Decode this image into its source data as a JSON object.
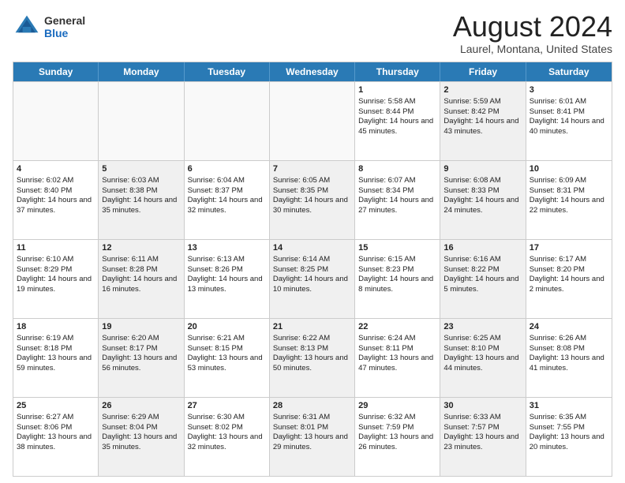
{
  "header": {
    "logo_general": "General",
    "logo_blue": "Blue",
    "month_title": "August 2024",
    "location": "Laurel, Montana, United States"
  },
  "days_of_week": [
    "Sunday",
    "Monday",
    "Tuesday",
    "Wednesday",
    "Thursday",
    "Friday",
    "Saturday"
  ],
  "weeks": [
    [
      {
        "day": "",
        "text": "",
        "empty": true,
        "shaded": false
      },
      {
        "day": "",
        "text": "",
        "empty": true,
        "shaded": false
      },
      {
        "day": "",
        "text": "",
        "empty": true,
        "shaded": false
      },
      {
        "day": "",
        "text": "",
        "empty": true,
        "shaded": false
      },
      {
        "day": "1",
        "text": "Sunrise: 5:58 AM\nSunset: 8:44 PM\nDaylight: 14 hours and 45 minutes.",
        "empty": false,
        "shaded": false
      },
      {
        "day": "2",
        "text": "Sunrise: 5:59 AM\nSunset: 8:42 PM\nDaylight: 14 hours and 43 minutes.",
        "empty": false,
        "shaded": true
      },
      {
        "day": "3",
        "text": "Sunrise: 6:01 AM\nSunset: 8:41 PM\nDaylight: 14 hours and 40 minutes.",
        "empty": false,
        "shaded": false
      }
    ],
    [
      {
        "day": "4",
        "text": "Sunrise: 6:02 AM\nSunset: 8:40 PM\nDaylight: 14 hours and 37 minutes.",
        "empty": false,
        "shaded": false
      },
      {
        "day": "5",
        "text": "Sunrise: 6:03 AM\nSunset: 8:38 PM\nDaylight: 14 hours and 35 minutes.",
        "empty": false,
        "shaded": true
      },
      {
        "day": "6",
        "text": "Sunrise: 6:04 AM\nSunset: 8:37 PM\nDaylight: 14 hours and 32 minutes.",
        "empty": false,
        "shaded": false
      },
      {
        "day": "7",
        "text": "Sunrise: 6:05 AM\nSunset: 8:35 PM\nDaylight: 14 hours and 30 minutes.",
        "empty": false,
        "shaded": true
      },
      {
        "day": "8",
        "text": "Sunrise: 6:07 AM\nSunset: 8:34 PM\nDaylight: 14 hours and 27 minutes.",
        "empty": false,
        "shaded": false
      },
      {
        "day": "9",
        "text": "Sunrise: 6:08 AM\nSunset: 8:33 PM\nDaylight: 14 hours and 24 minutes.",
        "empty": false,
        "shaded": true
      },
      {
        "day": "10",
        "text": "Sunrise: 6:09 AM\nSunset: 8:31 PM\nDaylight: 14 hours and 22 minutes.",
        "empty": false,
        "shaded": false
      }
    ],
    [
      {
        "day": "11",
        "text": "Sunrise: 6:10 AM\nSunset: 8:29 PM\nDaylight: 14 hours and 19 minutes.",
        "empty": false,
        "shaded": false
      },
      {
        "day": "12",
        "text": "Sunrise: 6:11 AM\nSunset: 8:28 PM\nDaylight: 14 hours and 16 minutes.",
        "empty": false,
        "shaded": true
      },
      {
        "day": "13",
        "text": "Sunrise: 6:13 AM\nSunset: 8:26 PM\nDaylight: 14 hours and 13 minutes.",
        "empty": false,
        "shaded": false
      },
      {
        "day": "14",
        "text": "Sunrise: 6:14 AM\nSunset: 8:25 PM\nDaylight: 14 hours and 10 minutes.",
        "empty": false,
        "shaded": true
      },
      {
        "day": "15",
        "text": "Sunrise: 6:15 AM\nSunset: 8:23 PM\nDaylight: 14 hours and 8 minutes.",
        "empty": false,
        "shaded": false
      },
      {
        "day": "16",
        "text": "Sunrise: 6:16 AM\nSunset: 8:22 PM\nDaylight: 14 hours and 5 minutes.",
        "empty": false,
        "shaded": true
      },
      {
        "day": "17",
        "text": "Sunrise: 6:17 AM\nSunset: 8:20 PM\nDaylight: 14 hours and 2 minutes.",
        "empty": false,
        "shaded": false
      }
    ],
    [
      {
        "day": "18",
        "text": "Sunrise: 6:19 AM\nSunset: 8:18 PM\nDaylight: 13 hours and 59 minutes.",
        "empty": false,
        "shaded": false
      },
      {
        "day": "19",
        "text": "Sunrise: 6:20 AM\nSunset: 8:17 PM\nDaylight: 13 hours and 56 minutes.",
        "empty": false,
        "shaded": true
      },
      {
        "day": "20",
        "text": "Sunrise: 6:21 AM\nSunset: 8:15 PM\nDaylight: 13 hours and 53 minutes.",
        "empty": false,
        "shaded": false
      },
      {
        "day": "21",
        "text": "Sunrise: 6:22 AM\nSunset: 8:13 PM\nDaylight: 13 hours and 50 minutes.",
        "empty": false,
        "shaded": true
      },
      {
        "day": "22",
        "text": "Sunrise: 6:24 AM\nSunset: 8:11 PM\nDaylight: 13 hours and 47 minutes.",
        "empty": false,
        "shaded": false
      },
      {
        "day": "23",
        "text": "Sunrise: 6:25 AM\nSunset: 8:10 PM\nDaylight: 13 hours and 44 minutes.",
        "empty": false,
        "shaded": true
      },
      {
        "day": "24",
        "text": "Sunrise: 6:26 AM\nSunset: 8:08 PM\nDaylight: 13 hours and 41 minutes.",
        "empty": false,
        "shaded": false
      }
    ],
    [
      {
        "day": "25",
        "text": "Sunrise: 6:27 AM\nSunset: 8:06 PM\nDaylight: 13 hours and 38 minutes.",
        "empty": false,
        "shaded": false
      },
      {
        "day": "26",
        "text": "Sunrise: 6:29 AM\nSunset: 8:04 PM\nDaylight: 13 hours and 35 minutes.",
        "empty": false,
        "shaded": true
      },
      {
        "day": "27",
        "text": "Sunrise: 6:30 AM\nSunset: 8:02 PM\nDaylight: 13 hours and 32 minutes.",
        "empty": false,
        "shaded": false
      },
      {
        "day": "28",
        "text": "Sunrise: 6:31 AM\nSunset: 8:01 PM\nDaylight: 13 hours and 29 minutes.",
        "empty": false,
        "shaded": true
      },
      {
        "day": "29",
        "text": "Sunrise: 6:32 AM\nSunset: 7:59 PM\nDaylight: 13 hours and 26 minutes.",
        "empty": false,
        "shaded": false
      },
      {
        "day": "30",
        "text": "Sunrise: 6:33 AM\nSunset: 7:57 PM\nDaylight: 13 hours and 23 minutes.",
        "empty": false,
        "shaded": true
      },
      {
        "day": "31",
        "text": "Sunrise: 6:35 AM\nSunset: 7:55 PM\nDaylight: 13 hours and 20 minutes.",
        "empty": false,
        "shaded": false
      }
    ]
  ]
}
